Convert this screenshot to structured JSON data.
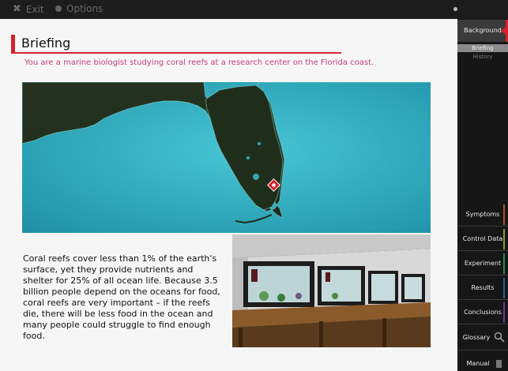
{
  "topbar": {
    "exit_label": "Exit",
    "options_label": "Options"
  },
  "briefing": {
    "title": "Briefing",
    "subtitle": "You are a marine biologist studying coral reefs at a research center on the Florida coast.",
    "body": "Coral reefs cover less than 1% of the earth's surface, yet they provide nutrients and shelter for 25% of all ocean life. Because 3.5 billion people depend on the oceans for food, coral reefs are very important – if the reefs die, there will be less food in the ocean and many people could struggle to find enough food."
  },
  "sidebar": {
    "background": "Background",
    "briefing": "Briefing",
    "history": "History",
    "symptoms": "Symptoms",
    "control_data": "Control Data",
    "experiment": "Experiment",
    "results": "Results",
    "conclusions": "Conclusions",
    "glossary": "Glossary",
    "manual": "Manual"
  },
  "colors": {
    "accent": "#d4222a",
    "subtitle": "#c0407a",
    "ocean": "#2fb0c3"
  }
}
